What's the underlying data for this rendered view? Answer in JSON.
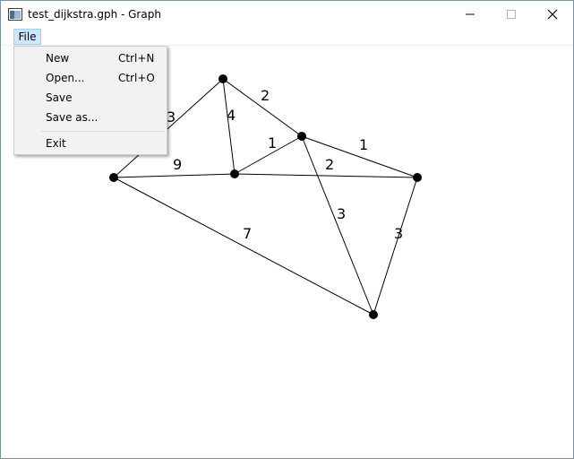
{
  "window": {
    "title": "test_dijkstra.gph - Graph",
    "controls": [
      "minimize-icon",
      "maximize-icon",
      "close-icon"
    ]
  },
  "menubar": {
    "items": [
      "File"
    ]
  },
  "file_menu": {
    "items": [
      {
        "label": "New",
        "shortcut": "Ctrl+N"
      },
      {
        "label": "Open...",
        "shortcut": "Ctrl+O"
      },
      {
        "label": "Save",
        "shortcut": ""
      },
      {
        "label": "Save as...",
        "shortcut": ""
      },
      {
        "label": "Exit",
        "shortcut": ""
      }
    ]
  },
  "graph": {
    "edge_weights": [
      "3",
      "4",
      "2",
      "1",
      "1",
      "9",
      "2",
      "3",
      "3",
      "7"
    ]
  },
  "colors": {
    "menu_highlight": "#cce8ff",
    "menu_background": "#f2f2f2",
    "edge": "#000000"
  }
}
